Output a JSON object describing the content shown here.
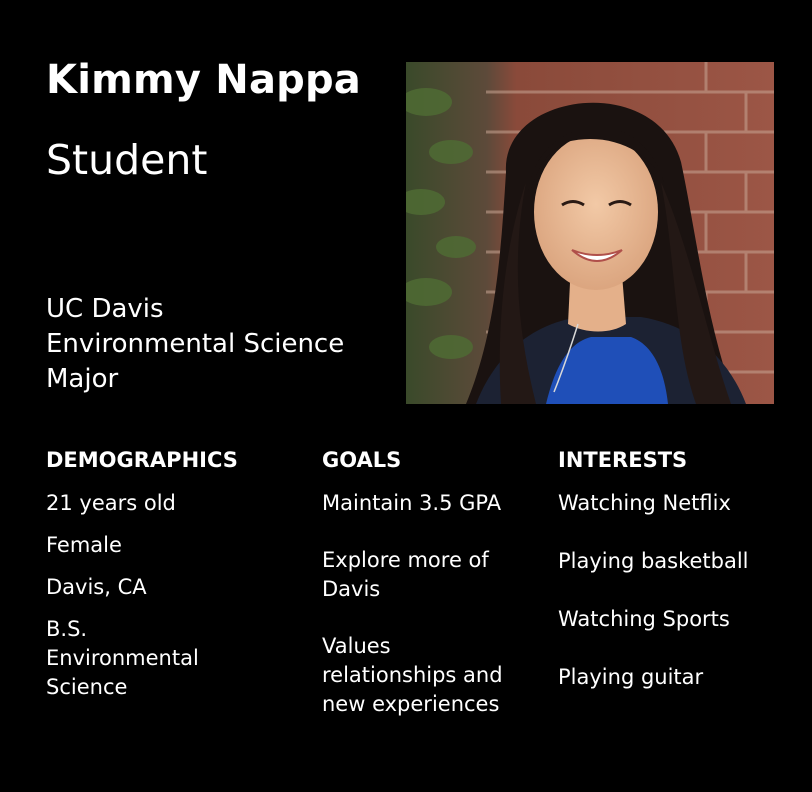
{
  "persona": {
    "name": "Kimmy Nappa",
    "role": "Student",
    "affiliation": [
      "UC Davis",
      "Environmental Science",
      "Major"
    ]
  },
  "photo": {
    "icon": "persona-portrait-photo"
  },
  "sections": {
    "demographics": {
      "heading": "DEMOGRAPHICS",
      "items": [
        "21 years old",
        "Female",
        "Davis, CA",
        "B.S. Environmental Science"
      ]
    },
    "goals": {
      "heading": "GOALS",
      "items": [
        "Maintain 3.5 GPA",
        "Explore more of Davis",
        "Values relationships and new experiences"
      ]
    },
    "interests": {
      "heading": "INTERESTS",
      "items": [
        "Watching Netflix",
        "Playing basketball",
        "Watching Sports",
        "Playing guitar"
      ]
    }
  },
  "colors": {
    "background": "#000000",
    "text": "#ffffff"
  }
}
